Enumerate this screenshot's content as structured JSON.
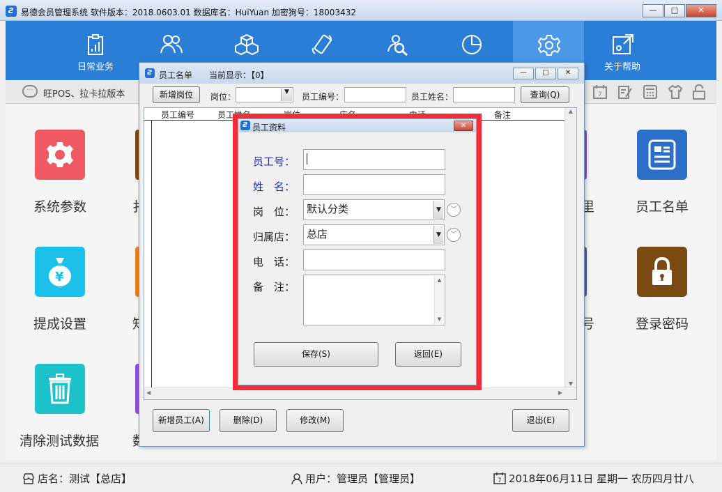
{
  "window": {
    "title": "易德会员管理系统   软件版本：2018.0603.01   数据库名：HuiYuan   加密狗号：18003432"
  },
  "toolbar": {
    "items": [
      {
        "label": "日常业务",
        "icon": "clipboard-icon"
      },
      {
        "label": "",
        "icon": "members-icon"
      },
      {
        "label": "",
        "icon": "boxes-icon"
      },
      {
        "label": "",
        "icon": "mobile-icon"
      },
      {
        "label": "",
        "icon": "search-person-icon"
      },
      {
        "label": "",
        "icon": "pie-chart-icon"
      },
      {
        "label": "",
        "icon": "gear-icon"
      },
      {
        "label": "关于帮助",
        "icon": "help-icon"
      }
    ]
  },
  "notice": {
    "text": "旺POS、拉卡拉版本"
  },
  "tiles": {
    "left": [
      {
        "label": "系统参数",
        "color": "#ef5a62",
        "icon": "gear-icon"
      },
      {
        "label": "提成设置",
        "color": "#1cc1ea",
        "icon": "money-bag-icon"
      },
      {
        "label": "清除测试数据",
        "color": "#1cc1c9",
        "icon": "trash-icon"
      }
    ],
    "left_partial": [
      "扌",
      "知",
      "数"
    ],
    "right": [
      {
        "label": "员工名单",
        "color": "#2b6fc8",
        "icon": "document-icon"
      },
      {
        "label": "登录密码",
        "color": "#7a4a12",
        "icon": "lock-icon"
      }
    ],
    "right_partial": [
      "里",
      "号"
    ]
  },
  "emp_list": {
    "title": "员工名单",
    "current_display": "当前显示：【0】",
    "add_post_button": "新增岗位",
    "post_label": "岗位：",
    "emp_no_label": "员工编号：",
    "emp_name_label": "员工姓名：",
    "query_button": "查询(Q)",
    "columns": [
      "员工编号",
      "员工姓名",
      "岗位",
      "店名",
      "电话",
      "备注"
    ],
    "add_emp_button": "新增员工(A)",
    "delete_button": "删除(D)",
    "edit_button": "修改(M)",
    "exit_button": "退出(E)"
  },
  "emp_info": {
    "title": "员工资料",
    "emp_no_label": "员工号：",
    "name_label": "姓　名：",
    "post_label": "岗　位：",
    "store_label": "归属店：",
    "phone_label": "电　话：",
    "remark_label": "备　注：",
    "post_value": "默认分类",
    "store_value": "总店",
    "save_button": "保存(S)",
    "back_button": "返回(E)"
  },
  "status": {
    "store": "店名：测试【总店】",
    "user": "用户：管理员【管理员】",
    "date": "2018年06月11日 星期一 农历四月廿八"
  },
  "colors": {
    "toolbar_blue": "#2b7ed6",
    "highlight_red": "#ef2e3a"
  }
}
